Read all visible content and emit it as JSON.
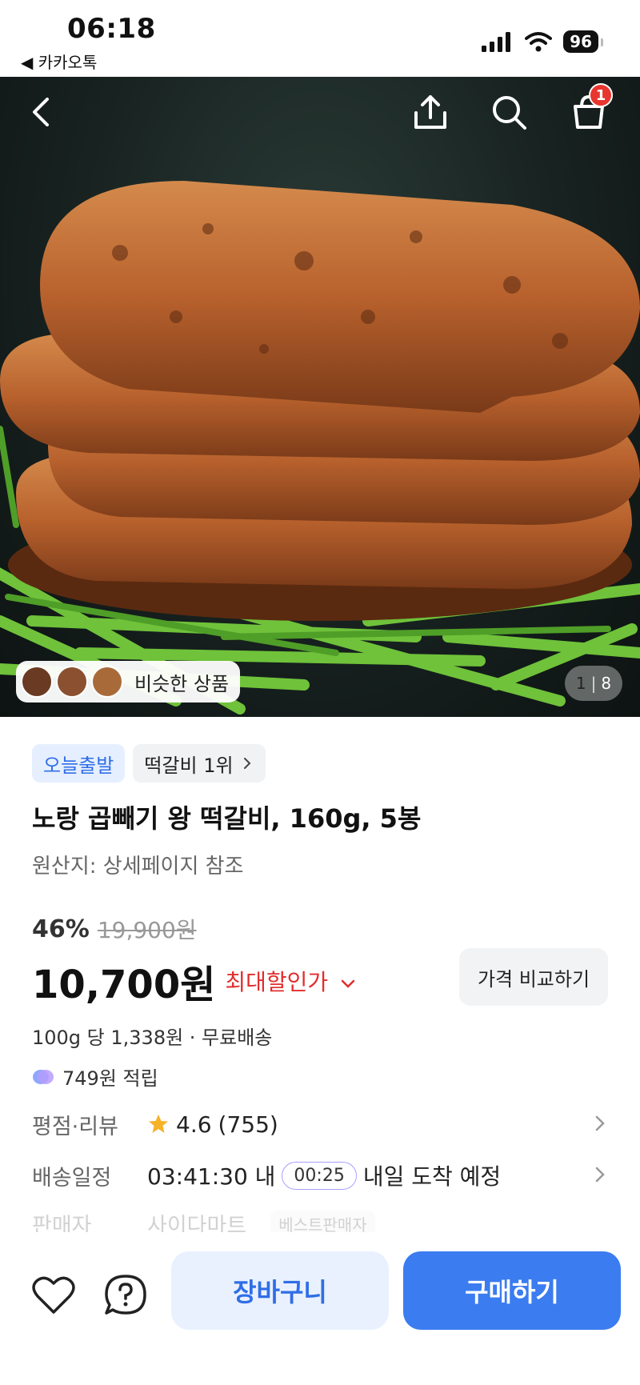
{
  "status": {
    "time": "06:18",
    "back_app": "◀ 카카오톡",
    "battery": "96"
  },
  "hero": {
    "cart_count": "1",
    "similar_label": "비슷한 상품",
    "page_current": "1",
    "page_total": "8"
  },
  "product": {
    "tags": [
      "오늘출발",
      "떡갈비 1위"
    ],
    "title": "노랑 곱빼기 왕 떡갈비, 160g, 5봉",
    "origin": "원산지: 상세페이지 참조",
    "discount_pct": "46%",
    "original_price": "19,900원",
    "price": "10,700원",
    "max_discount_label": "최대할인가",
    "compare_label": "가격 비교하기",
    "per_unit": "100g 당 1,338원 · 무료배송",
    "points": "749원 적립"
  },
  "info": {
    "rating_label": "평점·리뷰",
    "rating_value": "4.6",
    "review_count": "(755)",
    "delivery_label": "배송일정",
    "delivery_time": "03:41:30 내",
    "delivery_timer": "00:25",
    "delivery_eta": "내일 도착 예정",
    "seller_label": "판매자",
    "seller_name": "사이다마트",
    "seller_badge": "베스트판매자"
  },
  "bottom": {
    "cart_label": "장바구니",
    "buy_label": "구매하기"
  },
  "colors": {
    "accent": "#3b7cf0",
    "sale_red": "#e22d2d",
    "badge_red": "#e8352e"
  }
}
